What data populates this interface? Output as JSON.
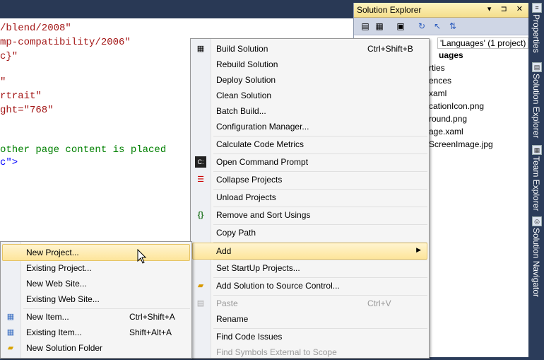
{
  "editor": {
    "lines": [
      {
        "text": "/blend/2008\"",
        "color": "#a31515"
      },
      {
        "text": "mp-compatibility/2006\"",
        "color": "#a31515"
      },
      {
        "text": "c}\"",
        "color": "#a31515"
      },
      {
        "text": "\"",
        "color": "#a31515"
      },
      {
        "text": "rtrait\"",
        "color": "#a31515"
      },
      {
        "text": "ght=\"768\"",
        "color": "#a31515"
      },
      {
        "text": "other page content is placed",
        "color": "#008000"
      },
      {
        "text": "c\">",
        "color": "#0000ff"
      }
    ]
  },
  "solution_explorer": {
    "title": "Solution Explorer",
    "title_buttons": "▾ ⊐ ✕",
    "items": [
      "'Languages' (1 project)",
      "uages",
      "rties",
      "ences",
      "xaml",
      "cationIcon.png",
      "round.png",
      "age.xaml",
      "ScreenImage.jpg"
    ]
  },
  "side_tabs": [
    "Properties",
    "Solution Explorer",
    "Team Explorer",
    "Solution Navigator"
  ],
  "main_menu": {
    "items": [
      {
        "label": "Build Solution",
        "shortcut": "Ctrl+Shift+B",
        "icon": "build-icon"
      },
      {
        "label": "Rebuild Solution",
        "shortcut": ""
      },
      {
        "label": "Deploy Solution",
        "shortcut": ""
      },
      {
        "label": "Clean Solution",
        "shortcut": ""
      },
      {
        "label": "Batch Build...",
        "shortcut": ""
      },
      {
        "label": "Configuration Manager...",
        "shortcut": ""
      },
      {
        "label": "Calculate Code Metrics",
        "shortcut": ""
      },
      {
        "label": "Open Command Prompt",
        "shortcut": "",
        "icon": "command-prompt-icon"
      },
      {
        "label": "Collapse Projects",
        "shortcut": "",
        "icon": "collapse-icon"
      },
      {
        "label": "Unload Projects",
        "shortcut": ""
      },
      {
        "label": "Remove and Sort Usings",
        "shortcut": "",
        "icon": "usings-icon"
      },
      {
        "label": "Copy Path",
        "shortcut": ""
      },
      {
        "label": "Add",
        "shortcut": ""
      },
      {
        "label": "Set StartUp Projects...",
        "shortcut": ""
      },
      {
        "label": "Add Solution to Source Control...",
        "shortcut": "",
        "icon": "source-control-icon"
      },
      {
        "label": "Paste",
        "shortcut": "Ctrl+V",
        "icon": "paste-icon"
      },
      {
        "label": "Rename",
        "shortcut": ""
      },
      {
        "label": "Find Code Issues",
        "shortcut": ""
      },
      {
        "label": "Find Symbols External to Scope",
        "shortcut": ""
      }
    ]
  },
  "sub_menu": {
    "items": [
      {
        "label": "New Project...",
        "shortcut": ""
      },
      {
        "label": "Existing Project...",
        "shortcut": ""
      },
      {
        "label": "New Web Site...",
        "shortcut": ""
      },
      {
        "label": "Existing Web Site...",
        "shortcut": ""
      },
      {
        "label": "New Item...",
        "shortcut": "Ctrl+Shift+A",
        "icon": "new-item-icon"
      },
      {
        "label": "Existing Item...",
        "shortcut": "Shift+Alt+A",
        "icon": "existing-item-icon"
      },
      {
        "label": "New Solution Folder",
        "shortcut": "",
        "icon": "folder-icon"
      }
    ]
  },
  "colors": {
    "menu_highlight": "#fde59a",
    "title_gradient": "#f4de8c",
    "chrome": "#293955"
  }
}
